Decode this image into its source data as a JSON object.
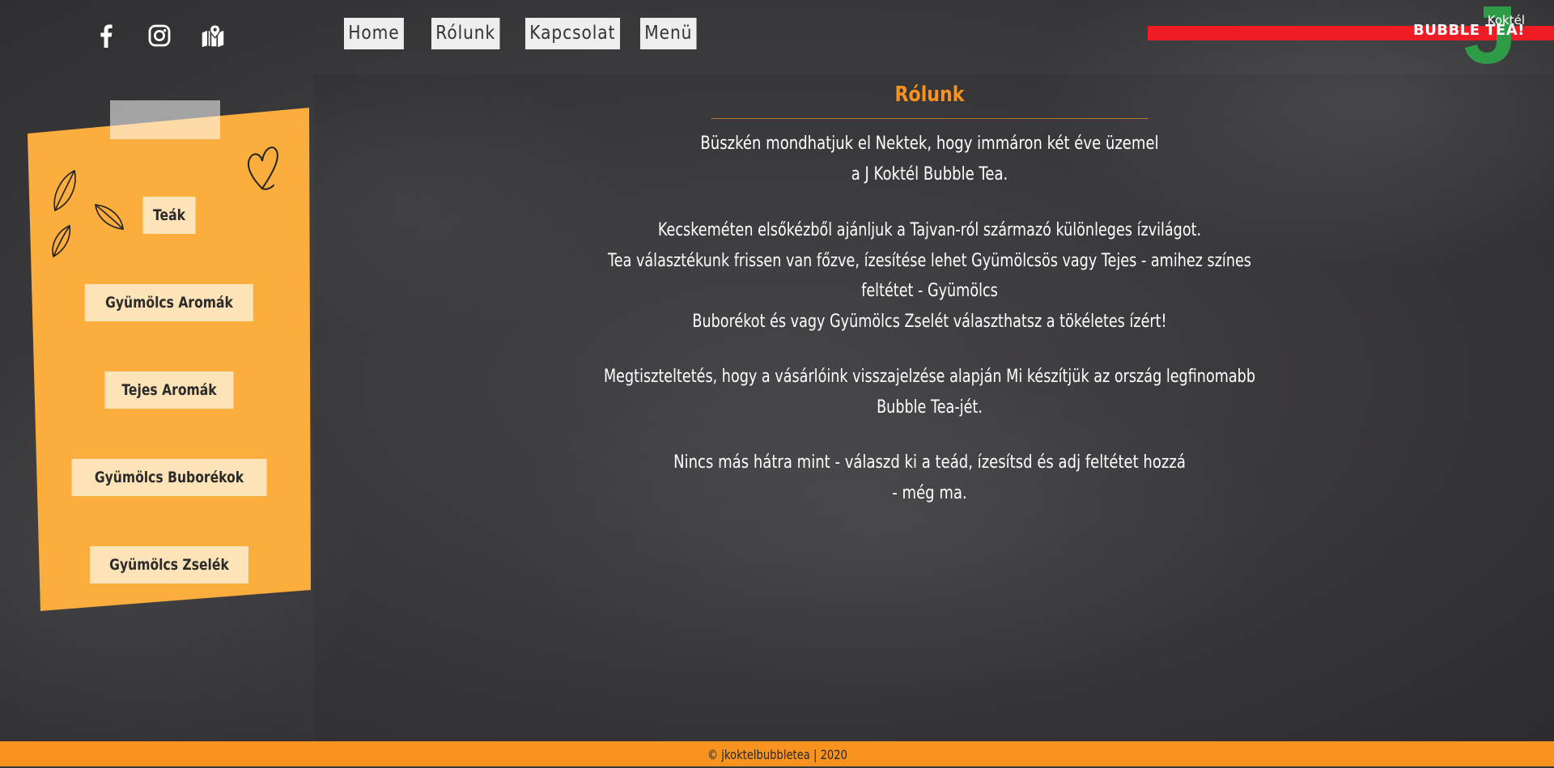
{
  "header": {
    "social": [
      {
        "name": "facebook-icon"
      },
      {
        "name": "instagram-icon"
      },
      {
        "name": "map-icon"
      }
    ],
    "nav": [
      {
        "label": "Home"
      },
      {
        "label": "Rólunk"
      },
      {
        "label": "Kapcsolat"
      },
      {
        "label": "Menü"
      }
    ],
    "logo": {
      "brand": "BUBBLE TEA!",
      "sub": "Koktél",
      "stripe_color": "#ee1c25",
      "mark_color": "#2e9c46"
    }
  },
  "sidebar": {
    "items": [
      {
        "label": "Teák"
      },
      {
        "label": "Gyümölcs Aromák"
      },
      {
        "label": "Tejes Aromák"
      },
      {
        "label": "Gyümölcs Buborékok"
      },
      {
        "label": "Gyümölcs Zselék"
      }
    ],
    "paper_color": "#fbad3d"
  },
  "main": {
    "title": "Rólunk",
    "paragraphs": [
      [
        "Büszkén mondhatjuk el Nektek, hogy immáron két éve üzemel",
        "a J Koktél Bubble Tea."
      ],
      [
        "Kecskeméten elsőkézből ajánljuk a Tajvan-ról származó különleges ízvilágot.",
        "Tea választékunk frissen van főzve, ízesítése lehet Gyümölcsös vagy Tejes - amihez színes feltétet - Gyümölcs",
        "Buborékot és vagy Gyümölcs Zselét választhatsz a tökéletes ízért!"
      ],
      [
        "Megtiszteltetés, hogy a vásárlóink visszajelzése alapján Mi készítjük az ország legfinomabb Bubble Tea-jét."
      ],
      [
        "Nincs más hátra mint - válaszd ki a teád, ízesítsd és adj feltétet hozzá",
        "- még ma."
      ]
    ]
  },
  "footer": {
    "text": "© jkoktelbubbletea | 2020"
  },
  "colors": {
    "accent": "#f7931e",
    "background": "#3a393c"
  }
}
